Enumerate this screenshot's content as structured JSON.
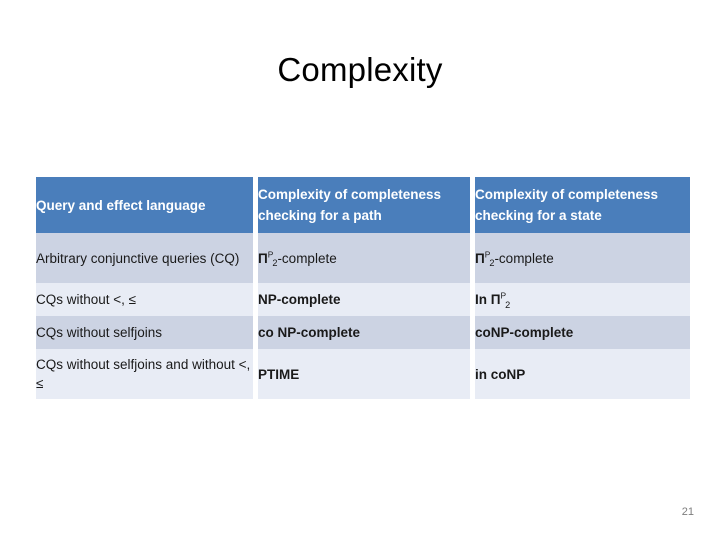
{
  "slide": {
    "title": "Complexity",
    "page_number": "21",
    "accent_color": "#4a7ebb",
    "row_dark_color": "#ccd3e3",
    "row_light_color": "#e8ecf5"
  },
  "table": {
    "headers": [
      "Query and effect language",
      "Complexity of completeness checking for a path",
      "Complexity of completeness checking for a state"
    ],
    "rows": [
      {
        "query": "Arbitrary conjunctive queries (CQ)",
        "path": {
          "prefix": "Π",
          "sup": "P",
          "sub": "2",
          "suffix": "-complete"
        },
        "state": {
          "prefix": "Π",
          "sup": "P",
          "sub": "2",
          "suffix": "-complete"
        }
      },
      {
        "query": "CQs without <, ≤",
        "path": {
          "prefix": "NP-complete",
          "sup": "",
          "sub": "",
          "suffix": ""
        },
        "state": {
          "prefix": "In Π",
          "sup": "P",
          "sub": "2",
          "suffix": ""
        }
      },
      {
        "query": "CQs without selfjoins",
        "path": {
          "prefix": "co NP-complete",
          "sup": "",
          "sub": "",
          "suffix": ""
        },
        "state": {
          "prefix": "coNP-complete",
          "sup": "",
          "sub": "",
          "suffix": ""
        }
      },
      {
        "query": "CQs without selfjoins and without <, ≤",
        "path": {
          "prefix": "PTIME",
          "sup": "",
          "sub": "",
          "suffix": ""
        },
        "state": {
          "prefix": "in coNP",
          "sup": "",
          "sub": "",
          "suffix": ""
        }
      }
    ]
  }
}
